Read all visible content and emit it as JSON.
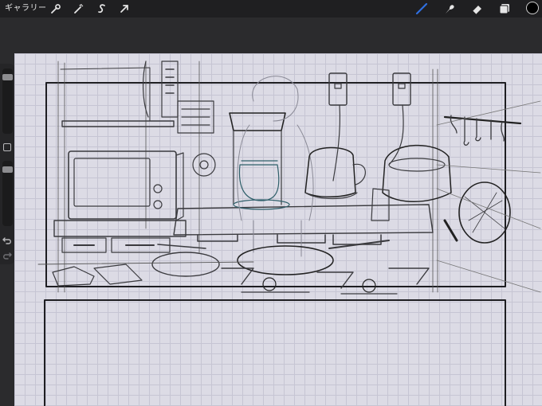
{
  "topbar": {
    "gallery_label": "ギャラリー",
    "left_tools": [
      {
        "icon": "wrench-icon",
        "name": "actions"
      },
      {
        "icon": "magic-wand-icon",
        "name": "adjustments"
      },
      {
        "icon": "selection-s-icon",
        "name": "selection"
      },
      {
        "icon": "arrow-cursor-icon",
        "name": "transform"
      }
    ],
    "right_tools": [
      {
        "icon": "brush-icon",
        "name": "brush",
        "active": true
      },
      {
        "icon": "smudge-icon",
        "name": "smudge"
      },
      {
        "icon": "eraser-icon",
        "name": "eraser"
      },
      {
        "icon": "layers-icon",
        "name": "layers"
      }
    ],
    "current_color": "#000000",
    "active_tool_color": "#2f6fe0"
  },
  "sidebar": {
    "brush_size_level": 0.1,
    "opacity_level": 0.1,
    "modify_icon": "square-icon",
    "undo_icon": "undo-arrow-icon",
    "redo_icon": "redo-arrow-icon"
  },
  "canvas": {
    "content": "kitchen-sketch",
    "paper_color": "#dcdbe5",
    "grid_color": "#c6c5d3"
  }
}
